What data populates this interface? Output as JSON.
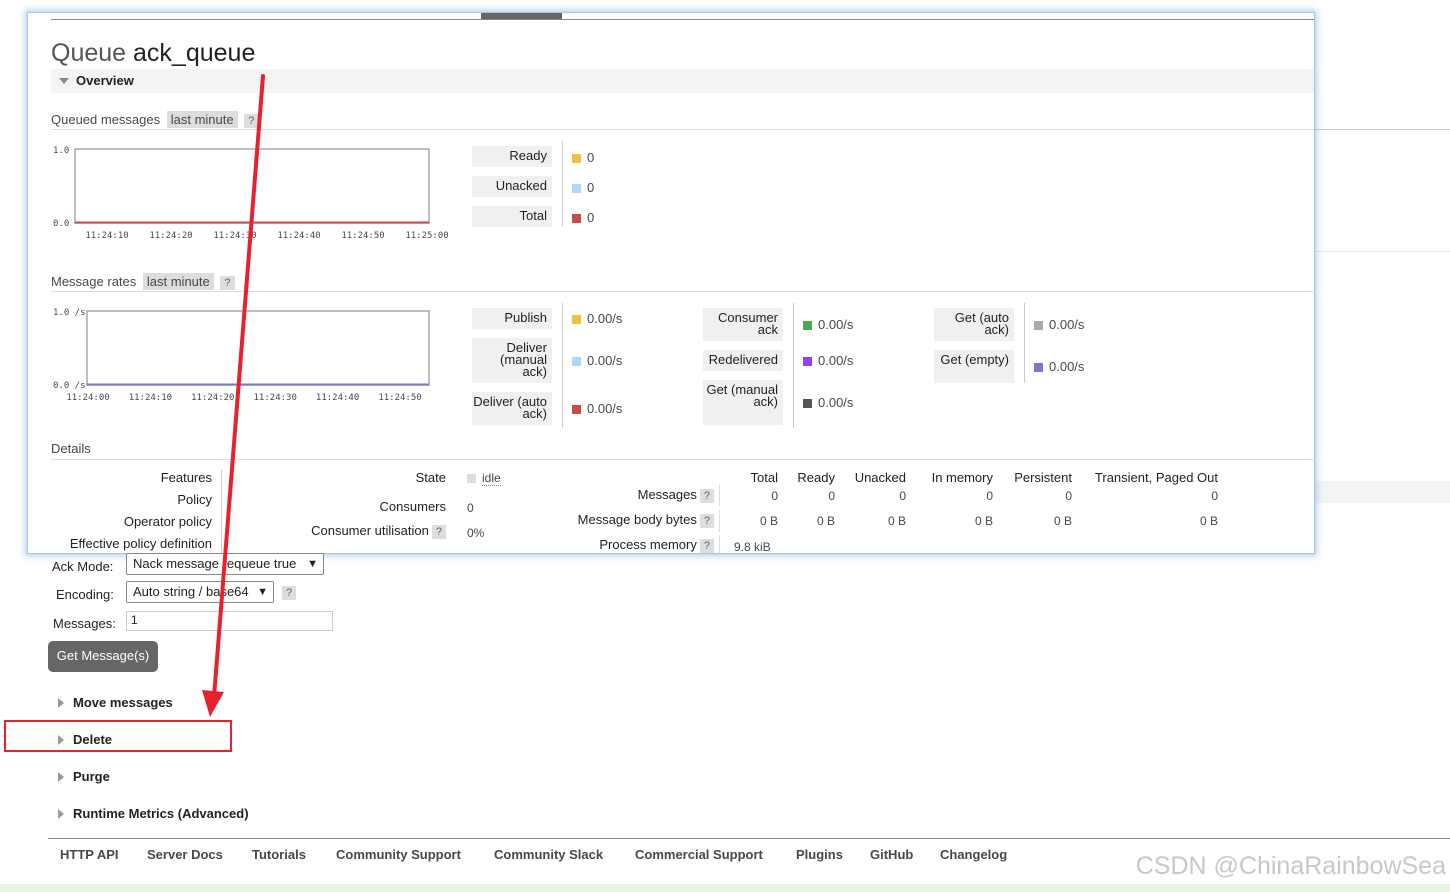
{
  "title": {
    "prefix": "Queue",
    "name": "ack_queue"
  },
  "overview_label": "Overview",
  "queued": {
    "header": "Queued messages",
    "range": "last minute",
    "help": "?",
    "y_top": "1.0",
    "y_bottom": "0.0",
    "x_ticks": [
      "11:24:10",
      "11:24:20",
      "11:24:30",
      "11:24:40",
      "11:24:50",
      "11:25:00"
    ],
    "legend": [
      {
        "label": "Ready",
        "value": "0",
        "color": "#edc240"
      },
      {
        "label": "Unacked",
        "value": "0",
        "color": "#afd8f8"
      },
      {
        "label": "Total",
        "value": "0",
        "color": "#cb4b4b"
      }
    ]
  },
  "rates": {
    "header": "Message rates",
    "range": "last minute",
    "help": "?",
    "y_top": "1.0 /s",
    "y_bottom": "0.0 /s",
    "x_ticks": [
      "11:24:00",
      "11:24:10",
      "11:24:20",
      "11:24:30",
      "11:24:40",
      "11:24:50"
    ],
    "col1": [
      {
        "label": "Publish",
        "value": "0.00/s",
        "color": "#edc240"
      },
      {
        "label": "Deliver (manual ack)",
        "value": "0.00/s",
        "color": "#afd8f8"
      },
      {
        "label": "Deliver (auto ack)",
        "value": "0.00/s",
        "color": "#cb4b4b"
      }
    ],
    "col2": [
      {
        "label": "Consumer ack",
        "value": "0.00/s",
        "color": "#4da74d"
      },
      {
        "label": "Redelivered",
        "value": "0.00/s",
        "color": "#9440ed"
      },
      {
        "label": "Get (manual ack)",
        "value": "0.00/s",
        "color": "#555555"
      }
    ],
    "col3": [
      {
        "label": "Get (auto ack)",
        "value": "0.00/s",
        "color": "#aaaaaa"
      },
      {
        "label": "Get (empty)",
        "value": "0.00/s",
        "color": "#7c79c3"
      }
    ]
  },
  "details": {
    "header": "Details",
    "left_labels": [
      "Features",
      "Policy",
      "Operator policy",
      "Effective policy definition"
    ],
    "state_label": "State",
    "state_value": "idle",
    "consumers_label": "Consumers",
    "consumers_value": "0",
    "util_label": "Consumer utilisation",
    "util_value": "0%",
    "help": "?",
    "columns": [
      "Total",
      "Ready",
      "Unacked",
      "In memory",
      "Persistent",
      "Transient, Paged Out"
    ],
    "rows": [
      {
        "label": "Messages",
        "values": [
          "0",
          "0",
          "0",
          "0",
          "0",
          "0"
        ]
      },
      {
        "label": "Message body bytes",
        "values": [
          "0 B",
          "0 B",
          "0 B",
          "0 B",
          "0 B",
          "0 B"
        ]
      },
      {
        "label": "Process memory",
        "values": [
          "9.8 kiB"
        ]
      }
    ]
  },
  "get_form": {
    "ack_mode_label": "Ack Mode:",
    "ack_mode_value": "Nack message requeue true",
    "encoding_label": "Encoding:",
    "encoding_value": "Auto string / base64",
    "help": "?",
    "messages_label": "Messages:",
    "messages_value": "1",
    "button": "Get Message(s)"
  },
  "sections": [
    "Move messages",
    "Delete",
    "Purge",
    "Runtime Metrics (Advanced)"
  ],
  "footer_links": [
    "HTTP API",
    "Server Docs",
    "Tutorials",
    "Community Support",
    "Community Slack",
    "Commercial Support",
    "Plugins",
    "GitHub",
    "Changelog"
  ],
  "watermark": "CSDN @ChinaRainbowSea",
  "colors": {
    "annotation": "#e8212e",
    "button": "#666666"
  }
}
